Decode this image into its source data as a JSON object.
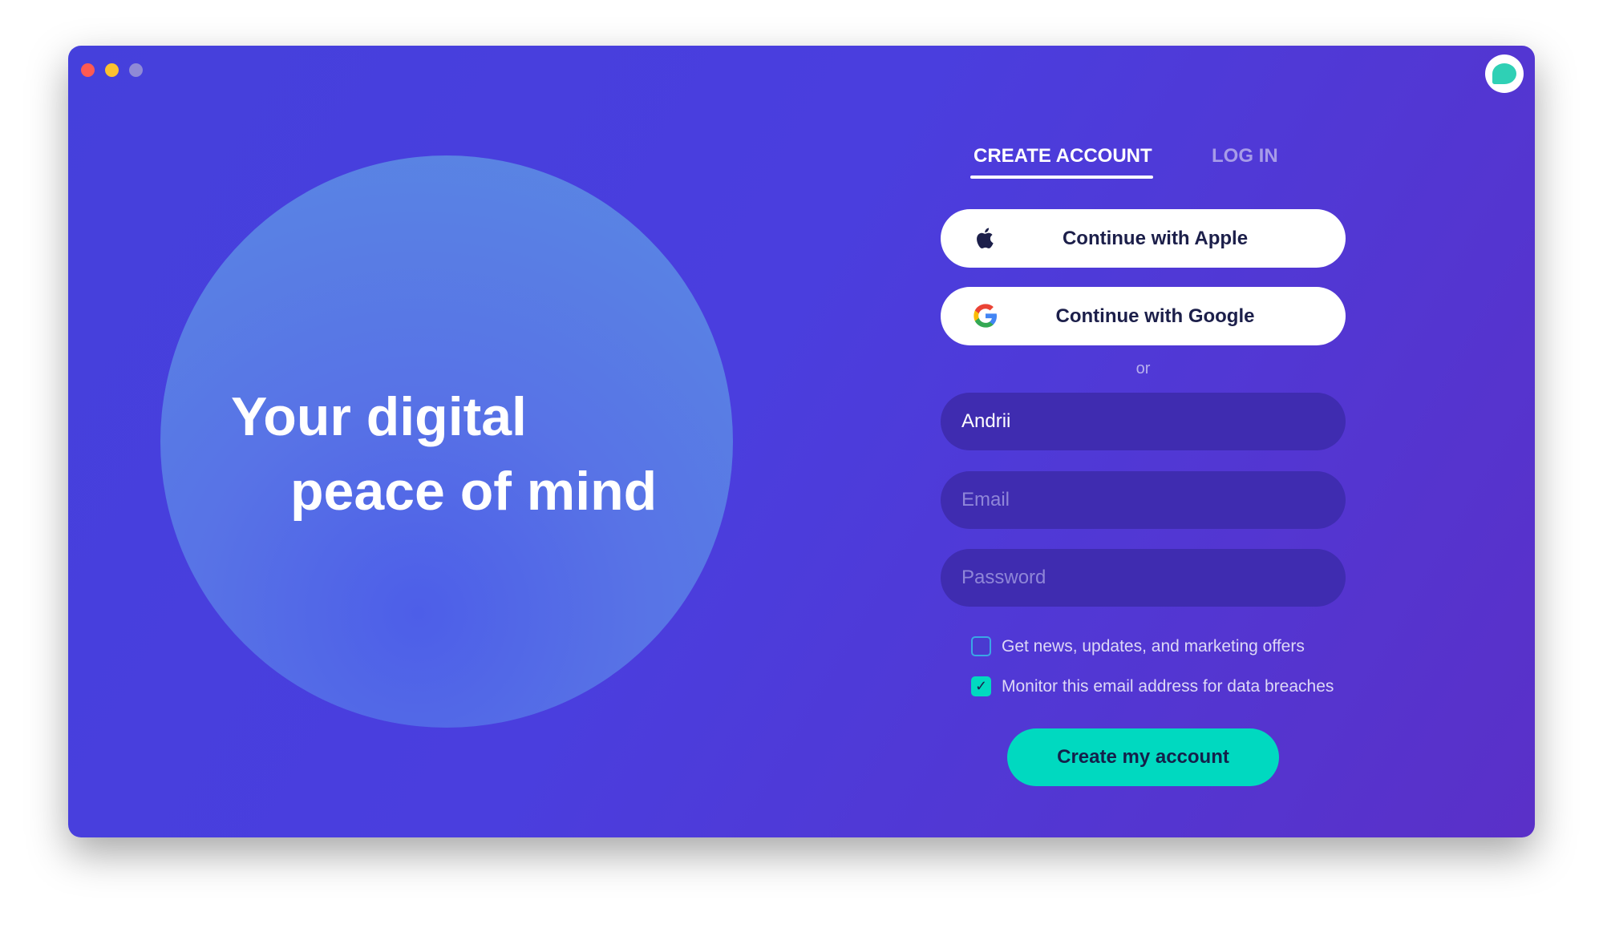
{
  "window": {
    "controls": {
      "close_color": "#ff5a52",
      "minimize_color": "#fcc12f",
      "zoom_color": "#8f8ad6"
    }
  },
  "hero": {
    "line1": "Your digital",
    "line2": "peace of mind"
  },
  "tabs": [
    {
      "label": "CREATE ACCOUNT",
      "active": true
    },
    {
      "label": "LOG IN",
      "active": false
    }
  ],
  "social": {
    "apple": "Continue with Apple",
    "google": "Continue with Google"
  },
  "divider": "or",
  "form": {
    "name_value": "Andrii",
    "email_placeholder": "Email",
    "password_placeholder": "Password"
  },
  "checkboxes": [
    {
      "label": "Get news, updates, and marketing offers",
      "checked": false
    },
    {
      "label": "Monitor this email address for data breaches",
      "checked": true
    }
  ],
  "submit": "Create my account",
  "colors": {
    "accent": "#00d9c0",
    "background": "#4a3ede"
  }
}
